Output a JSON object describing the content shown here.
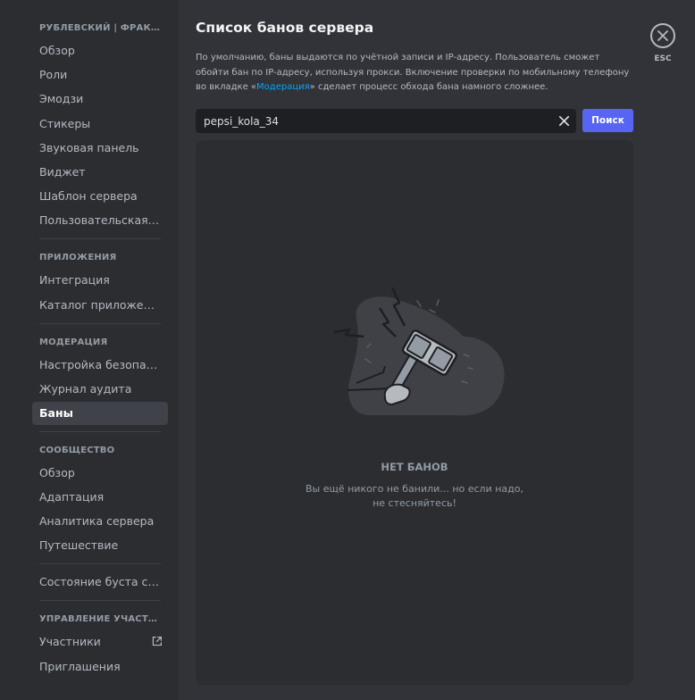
{
  "sidebar": {
    "server_header": "РУБЛЕВСКИЙ | ФРАКЦИИ",
    "server_items": [
      "Обзор",
      "Роли",
      "Эмодзи",
      "Стикеры",
      "Звуковая панель",
      "Виджет",
      "Шаблон сервера",
      "Пользовательская сс..."
    ],
    "apps_header": "ПРИЛОЖЕНИЯ",
    "apps_items": [
      "Интеграция",
      "Каталог приложений"
    ],
    "moderation_header": "МОДЕРАЦИЯ",
    "moderation_items": [
      "Настройка безопасно...",
      "Журнал аудита",
      "Баны"
    ],
    "community_header": "СООБЩЕСТВО",
    "community_items": [
      "Обзор",
      "Адаптация",
      "Аналитика сервера",
      "Путешествие"
    ],
    "boost_item": "Состояние буста сервера",
    "members_header": "УПРАВЛЕНИЕ УЧАСТНИКА...",
    "members_items": [
      "Участники",
      "Приглашения"
    ],
    "active_item": "Баны"
  },
  "main": {
    "title": "Список банов сервера",
    "description_part1": "По умолчанию, баны выдаются по учётной записи и IP-адресу. Пользователь сможет обойти бан по IP-адресу, используя прокси. Включение проверки по мобильному телефону во вкладке «",
    "description_link": "Модерация",
    "description_part2": "» сделает процесс обхода бана намного сложнее.",
    "search_value": "pepsi_kola_34",
    "search_button": "Поиск",
    "empty_title": "НЕТ БАНОВ",
    "empty_subtitle": "Вы ещё никого не банили... но если надо, не стесняйтесь!",
    "close_label": "ESC"
  },
  "colors": {
    "accent": "#5865f2",
    "link": "#00a8fc",
    "sidebar_bg": "#2b2d31",
    "main_bg": "#313338"
  }
}
